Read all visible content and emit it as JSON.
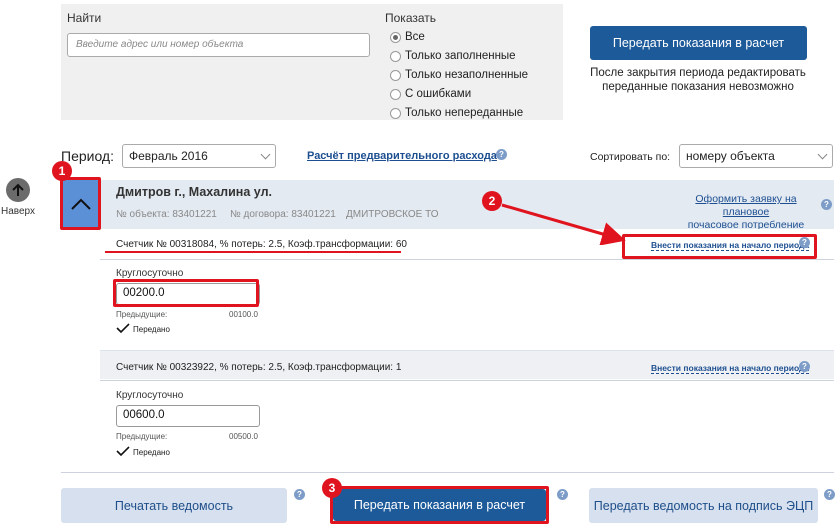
{
  "nav": {
    "up_label": "Наверх"
  },
  "filter": {
    "search_label": "Найти",
    "search_placeholder": "Введите адрес или номер объекта",
    "show_label": "Показать",
    "options": [
      "Все",
      "Только заполненные",
      "Только незаполненные",
      "С ошибками",
      "Только непереданные"
    ],
    "selected": "Все"
  },
  "top_action": {
    "button_label": "Передать показания в расчет",
    "note_line1": "После закрытия периода редактировать",
    "note_line2": "переданные показания невозможно"
  },
  "period": {
    "label": "Период:",
    "value": "Февраль 2016",
    "calc_link": "Расчёт предварительного расхода",
    "sort_label": "Сортировать по:",
    "sort_value": "номеру объекта"
  },
  "object": {
    "address": "Дмитров г., Махалина ул.",
    "object_no": "№ объекта: 83401221",
    "contract_no": "№ договора: 83401221",
    "district": "ДМИТРОВСКОЕ ТО",
    "plan_link_line1": "Оформить заявку на плановое",
    "plan_link_line2": "почасовое потребление"
  },
  "meters": [
    {
      "title": "Счетчик № 00318084, % потерь: 2.5, Коэф.трансформации: 60",
      "start_link": "Внести показания на начало периода",
      "zone": "Круглосуточно",
      "value": "00200.0",
      "prev_label": "Предыдущие:",
      "prev_value": "00100.0",
      "status": "Передано"
    },
    {
      "title": "Счетчик № 00323922, % потерь: 2.5, Коэф.трансформации: 1",
      "start_link": "Внести показания на начало периода",
      "zone": "Круглосуточно",
      "value": "00600.0",
      "prev_label": "Предыдущие:",
      "prev_value": "00500.0",
      "status": "Передано"
    }
  ],
  "bottom": {
    "print_label": "Печатать ведомость",
    "send_label": "Передать показания в расчет",
    "sign_label": "Передать ведомость на подпись ЭЦП"
  },
  "annotations": {
    "badge1": "1",
    "badge2": "2",
    "badge3": "3"
  },
  "colors": {
    "primary": "#1d5a9a",
    "accent_red": "#e0141e",
    "header_bg": "#e4eaf2",
    "collapse": "#5b8fd6"
  }
}
